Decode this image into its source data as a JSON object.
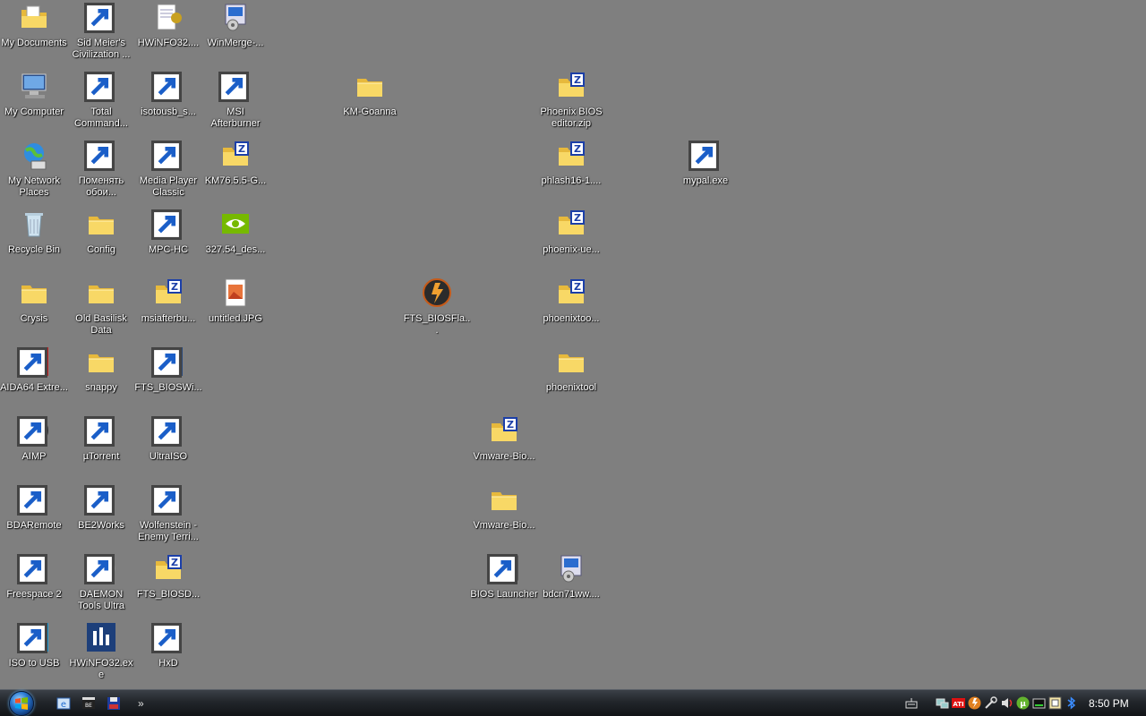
{
  "desktop": {
    "icons": [
      {
        "label": "My Documents",
        "kind": "folder-docs",
        "shortcut": false
      },
      {
        "label": "My Computer",
        "kind": "computer",
        "shortcut": false
      },
      {
        "label": "My Network Places",
        "kind": "network",
        "shortcut": false
      },
      {
        "label": "Recycle Bin",
        "kind": "recycle",
        "shortcut": false
      },
      {
        "label": "Crysis",
        "kind": "folder",
        "shortcut": false
      },
      {
        "label": "AIDA64 Extre...",
        "kind": "aida64",
        "shortcut": true
      },
      {
        "label": "AIMP",
        "kind": "aimp",
        "shortcut": true
      },
      {
        "label": "BDARemote",
        "kind": "bdaremote",
        "shortcut": true
      },
      {
        "label": "Freespace 2",
        "kind": "freespace",
        "shortcut": true
      },
      {
        "label": "ISO to USB",
        "kind": "isousb",
        "shortcut": true
      },
      {
        "label": "Sid Meier's Civilization ...",
        "kind": "civ",
        "shortcut": true
      },
      {
        "label": "Total Command...",
        "kind": "totalcmd",
        "shortcut": true
      },
      {
        "label": "Поменять обои...",
        "kind": "wallpaper",
        "shortcut": true
      },
      {
        "label": "Config",
        "kind": "folder",
        "shortcut": false
      },
      {
        "label": "Old Basilisk Data",
        "kind": "folder",
        "shortcut": false
      },
      {
        "label": "snappy",
        "kind": "folder",
        "shortcut": false
      },
      {
        "label": "µTorrent",
        "kind": "utorrent",
        "shortcut": true
      },
      {
        "label": "BE2Works",
        "kind": "chip",
        "shortcut": true
      },
      {
        "label": "DAEMON Tools Ultra",
        "kind": "daemon",
        "shortcut": true
      },
      {
        "label": "HWiNFO32.exe",
        "kind": "hwinfo",
        "shortcut": false
      },
      {
        "label": "HWiNFO32....",
        "kind": "notepad",
        "shortcut": false
      },
      {
        "label": "isotousb_s...",
        "kind": "installer",
        "shortcut": true
      },
      {
        "label": "Media Player Classic",
        "kind": "mpc",
        "shortcut": true
      },
      {
        "label": "MPC-HC",
        "kind": "mpchc",
        "shortcut": true
      },
      {
        "label": "msiafterbu...",
        "kind": "zip",
        "shortcut": false
      },
      {
        "label": "FTS_BIOSWi...",
        "kind": "bioswin",
        "shortcut": true
      },
      {
        "label": "UltraISO",
        "kind": "ultraiso",
        "shortcut": true
      },
      {
        "label": "Wolfenstein - Enemy Terri...",
        "kind": "wolf",
        "shortcut": true
      },
      {
        "label": "FTS_BIOSD...",
        "kind": "zip",
        "shortcut": false
      },
      {
        "label": "HxD",
        "kind": "hxd",
        "shortcut": true
      },
      {
        "label": "WinMerge-...",
        "kind": "installer",
        "shortcut": false
      },
      {
        "label": "MSI Afterburner",
        "kind": "msi",
        "shortcut": true
      },
      {
        "label": "KM76.5.5-G...",
        "kind": "zip",
        "shortcut": false
      },
      {
        "label": "327.54_des...",
        "kind": "nvidia",
        "shortcut": false
      },
      {
        "label": "untitled.JPG",
        "kind": "jpg",
        "shortcut": false
      },
      {
        "label": "KM-Goanna",
        "kind": "folder",
        "shortcut": false
      },
      {
        "label": "FTS_BIOSFla...",
        "kind": "flash",
        "shortcut": false
      },
      {
        "label": "Vmware-Bio...",
        "kind": "zip",
        "shortcut": false
      },
      {
        "label": "Vmware-Bio...",
        "kind": "folder",
        "shortcut": false
      },
      {
        "label": "BIOS Launcher",
        "kind": "window",
        "shortcut": true
      },
      {
        "label": "Phoenix BIOS editor.zip",
        "kind": "zip",
        "shortcut": false
      },
      {
        "label": "phlash16-1....",
        "kind": "zip",
        "shortcut": false
      },
      {
        "label": "phoenix-ue...",
        "kind": "zip",
        "shortcut": false
      },
      {
        "label": "phoenixtoo...",
        "kind": "zip",
        "shortcut": false
      },
      {
        "label": "phoenixtool",
        "kind": "folder",
        "shortcut": false
      },
      {
        "label": "bdcn71ww....",
        "kind": "installer",
        "shortcut": false
      },
      {
        "label": "mypal.exe",
        "kind": "raccoon",
        "shortcut": true
      }
    ]
  },
  "taskbar": {
    "quick_launch": [
      "ie-icon",
      "mpc-icon",
      "floppy-icon"
    ],
    "more_label": "»",
    "clock": "8:50 PM",
    "tray_icons": [
      "network-icon",
      "ati-icon",
      "flash-icon",
      "tools-icon",
      "volume-icon",
      "utorrent-icon",
      "battery-icon",
      "keyboard-layout-icon",
      "bluetooth-icon"
    ]
  },
  "colors": {
    "desktop_bg": "#7f7f7f",
    "folder_yellow": "#f2d35a",
    "zip_blue": "#1c3fa8"
  }
}
